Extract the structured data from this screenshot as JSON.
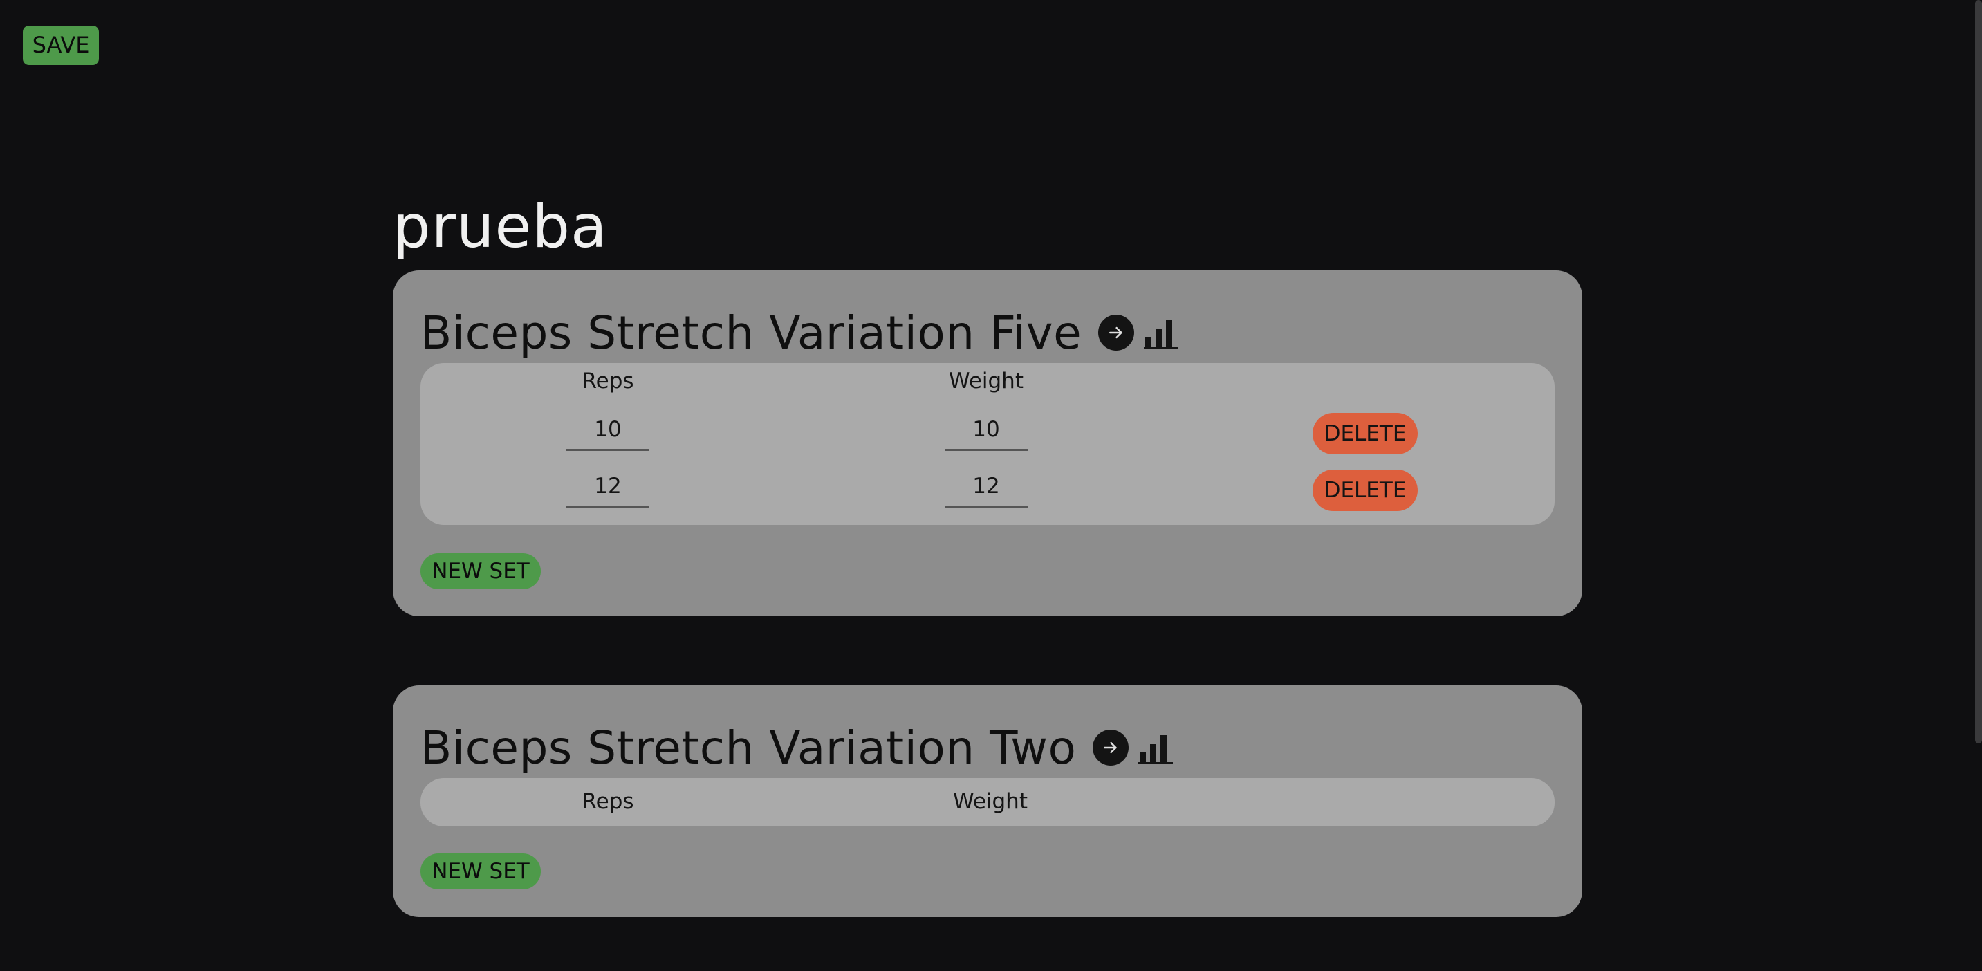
{
  "toolbar": {
    "save_label": "SAVE"
  },
  "page": {
    "title": "prueba"
  },
  "colors": {
    "background": "#0f0f11",
    "card": "#8d8d8d",
    "sets_panel": "#aaaaaa",
    "green_button": "#4e9a4a",
    "delete_button": "#dd5f3d"
  },
  "icons": {
    "go": "arrow-right-circle-icon",
    "stats": "bar-chart-icon"
  },
  "exercises": [
    {
      "name": "Biceps Stretch Variation Five",
      "columns": {
        "reps": "Reps",
        "weight": "Weight"
      },
      "sets": [
        {
          "reps": "10",
          "weight": "10",
          "delete_label": "DELETE"
        },
        {
          "reps": "12",
          "weight": "12",
          "delete_label": "DELETE"
        }
      ],
      "new_set_label": "NEW SET"
    },
    {
      "name": "Biceps Stretch Variation Two",
      "columns": {
        "reps": "Reps",
        "weight": "Weight"
      },
      "sets": [],
      "new_set_label": "NEW SET"
    }
  ]
}
